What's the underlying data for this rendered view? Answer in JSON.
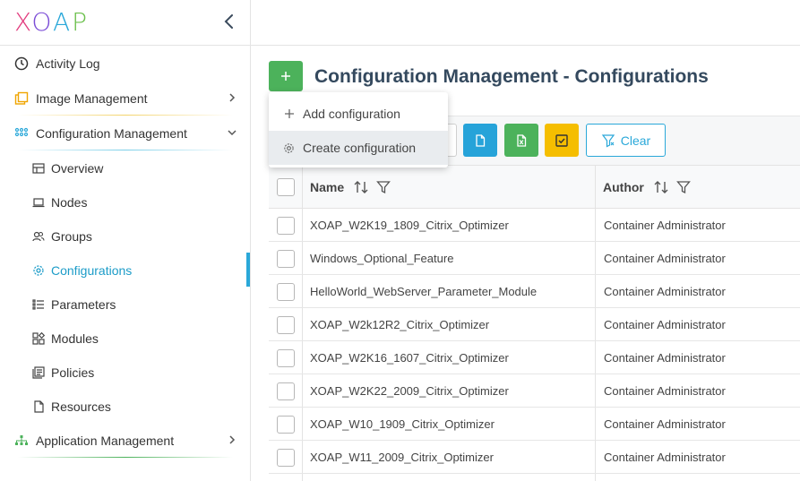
{
  "app": {
    "logo_letters": [
      "X",
      "O",
      "A",
      "P"
    ],
    "accent_color": "#2aa8d9",
    "primary_green": "#4cb25b"
  },
  "sidebar": {
    "collapse_icon": "chevron-left-icon",
    "items": [
      {
        "label": "Activity Log",
        "icon": "clock-icon"
      },
      {
        "label": "Image Management",
        "icon": "image-stack-icon",
        "chevron": "chevron-right-icon"
      },
      {
        "label": "Configuration Management",
        "icon": "grid-dots-icon",
        "chevron": "chevron-down-icon",
        "expanded": true
      },
      {
        "label": "Overview",
        "icon": "overview-icon"
      },
      {
        "label": "Nodes",
        "icon": "laptop-icon"
      },
      {
        "label": "Groups",
        "icon": "users-icon"
      },
      {
        "label": "Configurations",
        "icon": "gear-icon",
        "active": true
      },
      {
        "label": "Parameters",
        "icon": "list-icon"
      },
      {
        "label": "Modules",
        "icon": "modules-icon"
      },
      {
        "label": "Policies",
        "icon": "policy-icon"
      },
      {
        "label": "Resources",
        "icon": "file-icon"
      },
      {
        "label": "Application Management",
        "icon": "sitemap-icon",
        "chevron": "chevron-right-icon"
      }
    ]
  },
  "page": {
    "title": "Configuration Management - Configurations",
    "add_button_icon": "plus-icon"
  },
  "dropdown": {
    "items": [
      {
        "label": "Add configuration",
        "icon": "plus-icon"
      },
      {
        "label": "Create configuration",
        "icon": "gear-icon",
        "highlighted": true
      }
    ]
  },
  "toolbar": {
    "clear_label": "Clear",
    "buttons": [
      "file-icon",
      "excel-icon",
      "checkbox-icon"
    ]
  },
  "table": {
    "columns": [
      "Name",
      "Author"
    ],
    "rows": [
      {
        "name": "XOAP_W2K19_1809_Citrix_Optimizer",
        "author": "Container Administrator"
      },
      {
        "name": "Windows_Optional_Feature",
        "author": "Container Administrator"
      },
      {
        "name": "HelloWorld_WebServer_Parameter_Module",
        "author": "Container Administrator"
      },
      {
        "name": "XOAP_W2k12R2_Citrix_Optimizer",
        "author": "Container Administrator"
      },
      {
        "name": "XOAP_W2K16_1607_Citrix_Optimizer",
        "author": "Container Administrator"
      },
      {
        "name": "XOAP_W2K22_2009_Citrix_Optimizer",
        "author": "Container Administrator"
      },
      {
        "name": "XOAP_W10_1909_Citrix_Optimizer",
        "author": "Container Administrator"
      },
      {
        "name": "XOAP_W11_2009_Citrix_Optimizer",
        "author": "Container Administrator"
      }
    ]
  }
}
